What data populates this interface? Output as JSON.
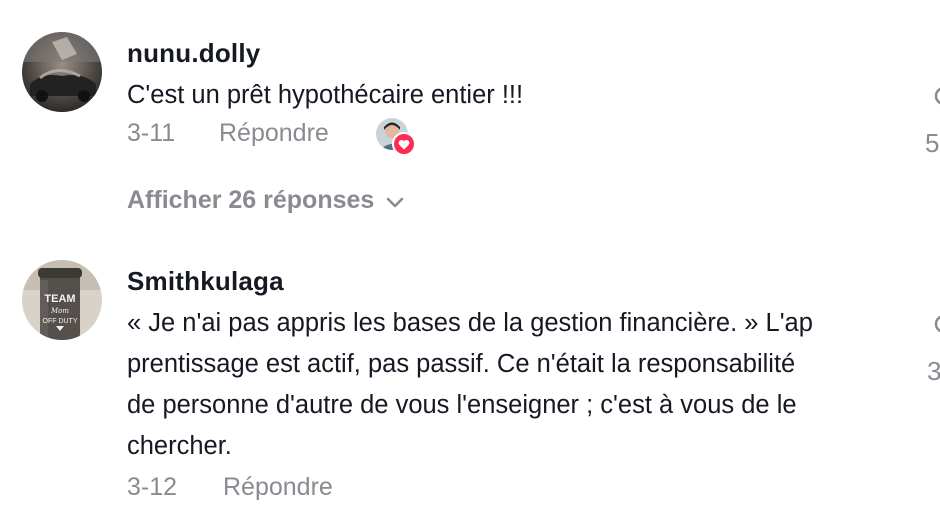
{
  "comments": [
    {
      "username": "nunu.dolly",
      "text": "C'est un prêt hypothécaire entier !!!",
      "date": "3-11",
      "reply_label": "Répondre",
      "like_count_partial": "5",
      "avatar_icon": "dark-car-avatar",
      "liked_by_creator": true
    },
    {
      "username": "Smithkulaga",
      "text": "« Je n'ai pas appris les bases de la gestion financière. » L'ap prentissage est actif, pas passif. Ce n'était la responsabilité de personne d'autre de vous l'enseigner ; c'est à vous de le chercher.",
      "text_lines": [
        "« Je n'ai pas appris les bases de la gestion financière. » L'ap",
        "prentissage est actif, pas passif. Ce n'était la responsabilité",
        "de personne d'autre de vous l'enseigner ; c'est à vous de le",
        "chercher."
      ],
      "date": "3-12",
      "reply_label": "Répondre",
      "like_count_partial": "3",
      "avatar_icon": "team-mom-tumbler-avatar"
    }
  ],
  "view_replies": {
    "label": "Afficher 26 réponses",
    "icon": "chevron-down-icon"
  },
  "colors": {
    "username": "#161823",
    "secondary": "#8a8b91",
    "heart": "#fe2c55"
  }
}
